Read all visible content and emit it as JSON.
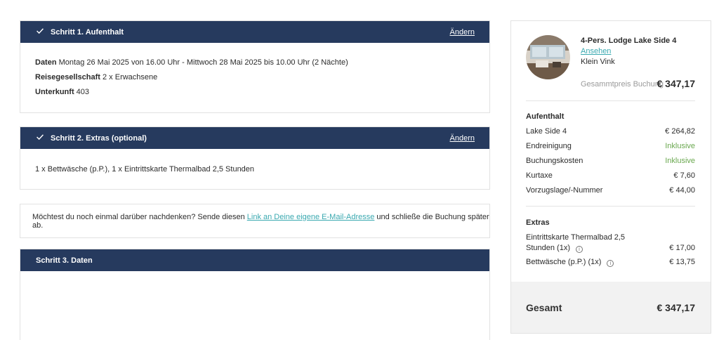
{
  "step1": {
    "title": "Schritt 1. Aufenthalt",
    "edit": "Ändern",
    "dates_label": "Daten",
    "dates_value": "Montag 26 Mai 2025 von 16.00 Uhr - Mittwoch 28 Mai 2025 bis 10.00 Uhr (2 Nächte)",
    "party_label": "Reisegesellschaft",
    "party_value": "2 x Erwachsene",
    "lodging_label": "Unterkunft",
    "lodging_value": "403"
  },
  "step2": {
    "title": "Schritt 2. Extras (optional)",
    "edit": "Ändern",
    "extras_text": "1 x Bettwäsche (p.P.), 1 x Eintrittskarte Thermalbad 2,5 Stunden"
  },
  "notice": {
    "before": "Möchtest du noch einmal darüber nachdenken? Sende diesen ",
    "link": "Link an Deine eigene E-Mail-Adresse",
    "after": " und schließe die Buchung später ab."
  },
  "step3": {
    "title": "Schritt 3. Daten"
  },
  "summary": {
    "property_name": "4-Pers. Lodge Lake Side 4",
    "view_link": "Ansehen",
    "location": "Klein Vink",
    "total_label": "Gesammtpreis Buchung",
    "total_value": "€ 347,17",
    "stay": {
      "title": "Aufenthalt",
      "lines": [
        {
          "label": "Lake Side 4",
          "value": "€ 264,82"
        },
        {
          "label": "Endreinigung",
          "value": "Inklusive"
        },
        {
          "label": "Buchungskosten",
          "value": "Inklusive"
        },
        {
          "label": "Kurtaxe",
          "value": "€ 7,60"
        },
        {
          "label": "Vorzugslage/-Nummer",
          "value": "€ 44,00"
        }
      ]
    },
    "extras": {
      "title": "Extras",
      "line1_label_a": "Eintrittskarte Thermalbad 2,5",
      "line1_label_b": "Stunden (1x)",
      "line1_value": "€ 17,00",
      "line2_label": "Bettwäsche (p.P.) (1x)",
      "line2_value": "€ 13,75",
      "info_glyph": "i"
    },
    "grand_label": "Gesamt",
    "grand_value": "€ 347,17"
  },
  "colors": {
    "header_bg": "#263a5e",
    "link": "#3aa9b0",
    "inclusive": "#6aa84f"
  }
}
